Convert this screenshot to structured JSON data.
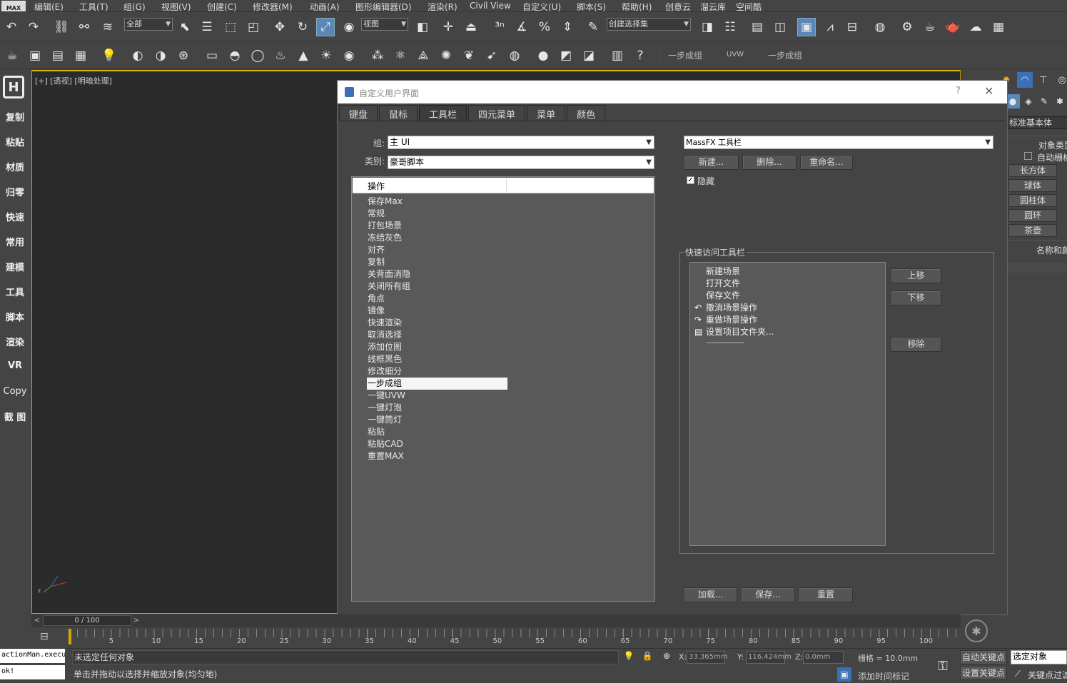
{
  "menubar": {
    "logo": "MAX",
    "items": [
      "编辑(E)",
      "工具(T)",
      "组(G)",
      "视图(V)",
      "创建(C)",
      "修改器(M)",
      "动画(A)",
      "图形编辑器(D)",
      "渲染(R)",
      "Civil View",
      "自定义(U)",
      "脚本(S)",
      "帮助(H)",
      "创意云",
      "溜云库",
      "空间酷"
    ]
  },
  "toolbar": {
    "selection_filter": "全部",
    "ref_coord": "视图",
    "named_selection": "创建选择集",
    "custom_buttons": [
      "一步成组",
      "UVW",
      "一步成组"
    ]
  },
  "leftbar": {
    "items": [
      "复制",
      "粘贴",
      "材质",
      "归零",
      "快速",
      "常用",
      "建模",
      "工具",
      "脚本",
      "渲染",
      "VR",
      "Copy",
      "截 图"
    ]
  },
  "viewport": {
    "label": "[+] [透视] [明暗处理]"
  },
  "rightpanel": {
    "category": "标准基本体",
    "section": "对象类型",
    "autogrid": "自动栅格",
    "buttons": [
      "长方体",
      "球体",
      "圆柱体",
      "圆环",
      "茶壶"
    ],
    "name_color": "名称和颜色"
  },
  "dialog": {
    "title": "自定义用户界面",
    "help": "?",
    "close": "✕",
    "tabs": [
      "键盘",
      "鼠标",
      "工具栏",
      "四元菜单",
      "菜单",
      "颜色"
    ],
    "active_tab": "工具栏",
    "group_label": "组:",
    "group_value": "主 UI",
    "category_label": "类别:",
    "category_value": "豪哥脚本",
    "action_header": "操作",
    "actions": [
      "保存Max",
      "常规",
      "打包场景",
      "冻结灰色",
      "对齐",
      "复制",
      "关背面消隐",
      "关闭所有组",
      "角点",
      "镜像",
      "快速渲染",
      "取消选择",
      "添加位图",
      "线框黑色",
      "修改细分",
      "一步成组",
      "一键UVW",
      "一键灯泡",
      "一键筒灯",
      "粘贴",
      "粘贴CAD",
      "重置MAX"
    ],
    "selected_action": "一步成组",
    "toolbar_select": "MassFX 工具栏",
    "btn_new": "新建...",
    "btn_delete": "删除...",
    "btn_rename": "重命名...",
    "hide_label": "隐藏",
    "hide_checked": "✓",
    "qa_title": "快速访问工具栏",
    "qa_items": [
      "新建场景",
      "打开文件",
      "保存文件",
      "撤消场景操作",
      "重做场景操作",
      "设置项目文件夹...",
      "---------------"
    ],
    "btn_up": "上移",
    "btn_down": "下移",
    "btn_remove": "移除",
    "btn_load": "加载...",
    "btn_save": "保存...",
    "btn_reset": "重置"
  },
  "timeline": {
    "frame_display": "0 / 100",
    "ticks": [
      "5",
      "10",
      "15",
      "20",
      "25",
      "30",
      "35",
      "40",
      "45",
      "50",
      "55",
      "60",
      "65",
      "70",
      "75",
      "80",
      "85",
      "90",
      "95",
      "100"
    ]
  },
  "status": {
    "script_listener": "actionMan.execu",
    "script_output": "ok!",
    "selection_status": "未选定任何对象",
    "prompt": "单击并拖动以选择并缩放对象(均匀地)",
    "x_label": "X:",
    "x_value": "33.365mm",
    "y_label": "Y:",
    "y_value": "116.424mm",
    "z_label": "Z:",
    "z_value": "0.0mm",
    "grid": "栅格 = 10.0mm",
    "add_time_tag": "添加时间标记",
    "auto_key": "自动关键点",
    "set_key": "设置关键点",
    "selected_set": "选定对象",
    "key_filter": "关键点过滤器"
  }
}
